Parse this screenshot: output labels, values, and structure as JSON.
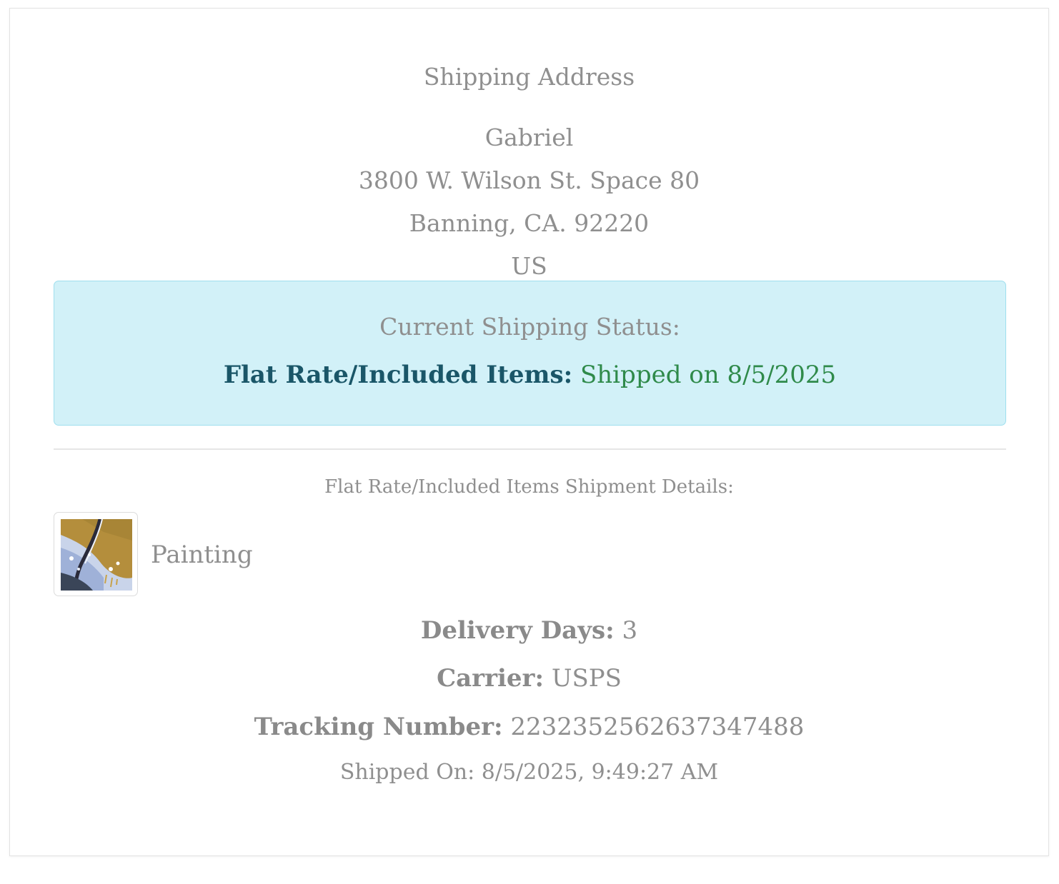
{
  "shipping_address": {
    "title": "Shipping Address",
    "name": "Gabriel",
    "street": "3800 W. Wilson St. Space 80",
    "city_state_zip": "Banning, CA. 92220",
    "country": "US"
  },
  "status": {
    "heading": "Current Shipping Status:",
    "label": "Flat Rate/Included Items:",
    "value": "Shipped on 8/5/2025"
  },
  "shipment_details": {
    "heading": "Flat Rate/Included Items Shipment Details:",
    "item": {
      "name": "Painting",
      "thumbnail_icon": "painting-thumbnail"
    },
    "delivery_days_label": "Delivery Days:",
    "delivery_days_value": "3",
    "carrier_label": "Carrier:",
    "carrier_value": "USPS",
    "tracking_label": "Tracking Number:",
    "tracking_value": "2232352562637347488",
    "shipped_on": "Shipped On: 8/5/2025, 9:49:27 AM"
  },
  "colors": {
    "status_bg": "#d2f1f8",
    "status_border": "#9fdfee",
    "status_label": "#1a5668",
    "status_value": "#2f8a4a",
    "text_muted": "#8f8f8f"
  }
}
